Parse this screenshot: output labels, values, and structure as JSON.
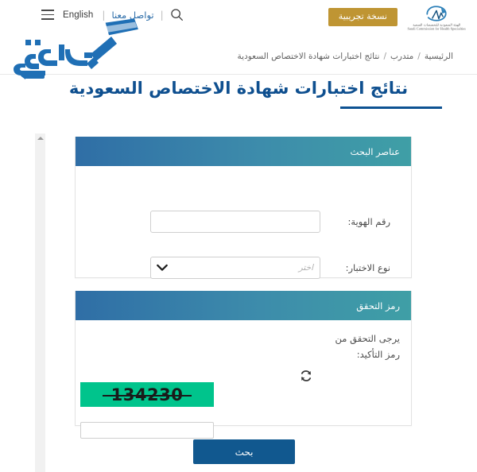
{
  "topbar": {
    "menu_icon": "hamburger-menu-icon",
    "language_label": "English",
    "separator": "|",
    "contact_label": "تواصل معنا",
    "search_icon": "search-icon",
    "trial_badge": "نسخة تجريبية",
    "org_logo": {
      "icon": "scfhs-logo-icon",
      "name_ar": "الهيئة السعودية للتخصصات الصحية",
      "name_en": "Saudi Commission for Health Specialties"
    }
  },
  "watermark": {
    "icon": "mohtwa-watermark-logo",
    "text": "محتوى"
  },
  "breadcrumb": {
    "items": [
      {
        "label": "الرئيسية"
      },
      {
        "label": "متدرب"
      },
      {
        "label": "نتائج اختبارات شهادة الاختصاص السعودية"
      }
    ],
    "separator": "/"
  },
  "page": {
    "title": "نتائج اختبارات شهادة الاختصاص السعودية"
  },
  "search_panel": {
    "header_title": "عناصر البحث",
    "id_label": "رقم الهوية:",
    "id_value": "",
    "id_placeholder": "",
    "exam_type_label": "نوع الاختبار:",
    "exam_type_placeholder": "اختر",
    "chevron_icon": "chevron-down-icon"
  },
  "verify_panel": {
    "header_title": "رمز التحقق",
    "instruction": "يرجى التحقق من رمز التأكيد:",
    "refresh_icon": "refresh-icon",
    "captcha_code": "134230",
    "captcha_bg_color": "#00c48c",
    "captcha_input_value": "",
    "captcha_input_placeholder": ""
  },
  "actions": {
    "submit_label": "بحث"
  },
  "colors": {
    "title_blue": "#0e4f8f",
    "panel_header_left": "#3f9fa6",
    "panel_header_right": "#2f6ea6",
    "button_blue": "#11588f",
    "badge_gold": "#bf9533",
    "captcha_green": "#00c48c"
  },
  "scrollbar": {
    "up_arrow_icon": "scroll-up-arrow-icon"
  }
}
